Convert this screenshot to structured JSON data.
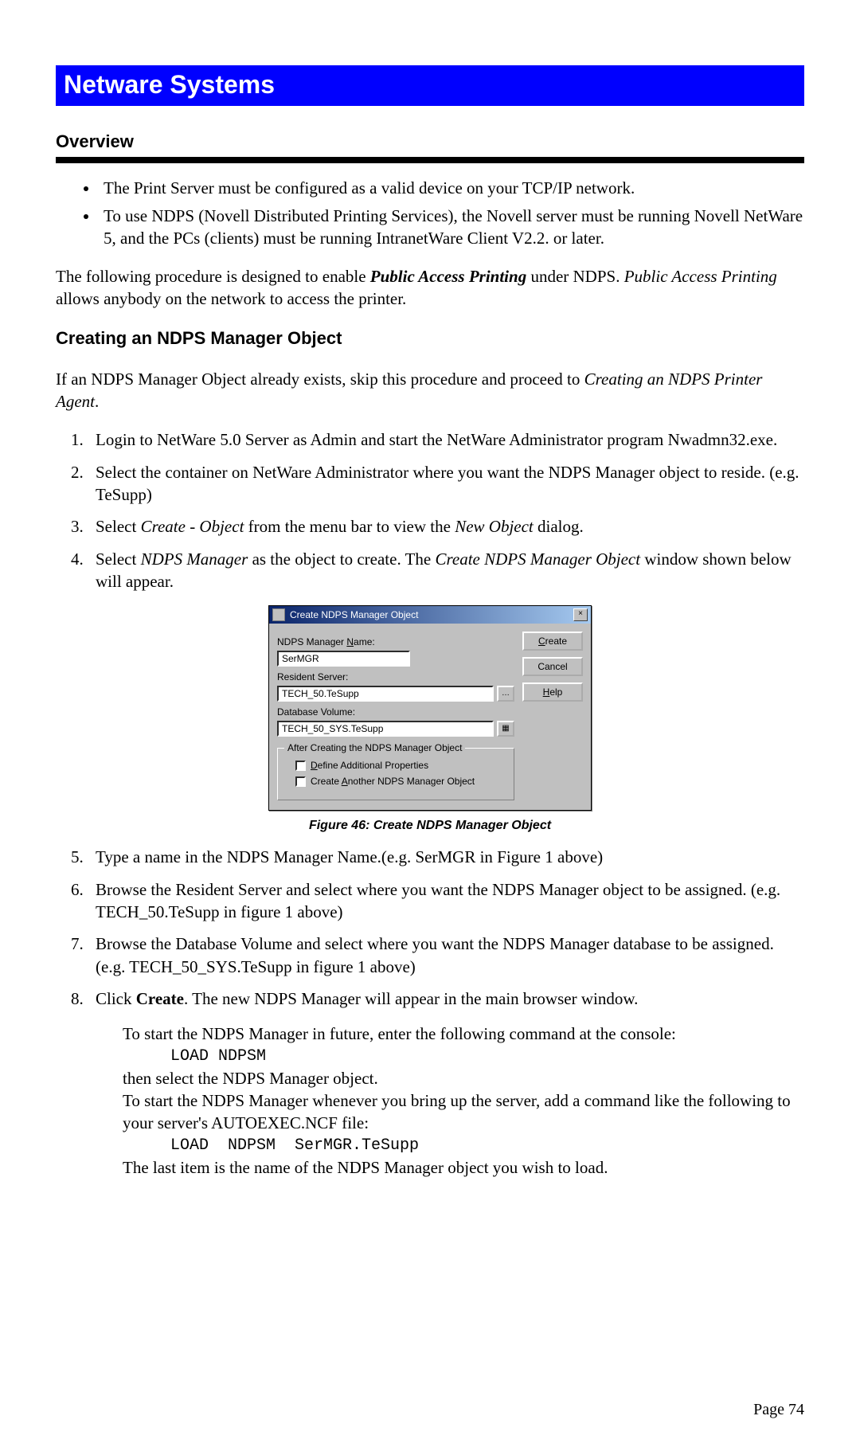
{
  "banner": "Netware Systems",
  "overview_heading": "Overview",
  "bullets": {
    "b1": "The Print Server must be configured as a valid device on your TCP/IP network.",
    "b2": "To use NDPS (Novell Distributed Printing Services), the Novell server must be running Novell NetWare 5, and the PCs (clients) must be running IntranetWare Client V2.2. or later."
  },
  "para1_a": "The following procedure is designed to enable ",
  "para1_b": "Public Access Printing",
  "para1_c": " under NDPS. ",
  "para1_d": "Public Access Printing",
  "para1_e": " allows anybody on the network to access the printer.",
  "sub_heading": "Creating an NDPS Manager Object",
  "para2_a": "If an NDPS Manager Object already exists, skip this procedure and proceed to ",
  "para2_b": "Creating an NDPS Printer Agent",
  "para2_c": ".",
  "steps": {
    "s1": "Login to NetWare 5.0 Server as Admin and start the NetWare Administrator program Nwadmn32.exe.",
    "s2": "Select the container on NetWare Administrator where you want the NDPS Manager object to reside. (e.g.  TeSupp)",
    "s3_a": "Select ",
    "s3_b": "Create - Object",
    "s3_c": " from the menu bar to view the ",
    "s3_d": "New Object",
    "s3_e": " dialog.",
    "s4_a": "Select ",
    "s4_b": "NDPS Manager",
    "s4_c": " as the object to create. The ",
    "s4_d": "Create NDPS Manager Object",
    "s4_e": " window shown below will appear.",
    "s5": "Type a name in the NDPS Manager Name.(e.g. SerMGR in Figure 1 above)",
    "s6": "Browse the Resident Server and select where you want the NDPS Manager object to be assigned. (e.g.  TECH_50.TeSupp in figure 1 above)",
    "s7": "Browse the Database Volume and select where you want the NDPS Manager database to be assigned. (e.g.  TECH_50_SYS.TeSupp in figure 1 above)",
    "s8_a": "Click ",
    "s8_b": "Create",
    "s8_c": ". The new NDPS Manager will appear in the main browser window."
  },
  "dialog": {
    "title": "Create NDPS Manager Object",
    "close": "×",
    "label_name_pre": "NDPS Manager ",
    "label_name_u": "N",
    "label_name_post": "ame:",
    "name_value": "SerMGR",
    "label_server": "Resident Server:",
    "server_value": "TECH_50.TeSupp",
    "browse1": "…",
    "label_volume": "Database Volume:",
    "volume_value": "TECH_50_SYS.TeSupp",
    "browse2": "▦",
    "group_legend": "After Creating the NDPS Manager Object",
    "chk1_u": "D",
    "chk1_post": "efine Additional Properties",
    "chk2_pre": "Create ",
    "chk2_u": "A",
    "chk2_post": "nother NDPS Manager Object",
    "btn_create_u": "C",
    "btn_create_post": "reate",
    "btn_cancel": "Cancel",
    "btn_help_u": "H",
    "btn_help_post": "elp"
  },
  "fig_caption": "Figure 46: Create NDPS Manager Object",
  "after": {
    "l1": "To start the NDPS Manager in future, enter the following command at the console:",
    "c1": "LOAD NDPSM",
    "l2": "then select the NDPS Manager object.",
    "l3": "To start the NDPS Manager whenever you bring up the server, add a command like the following to your server's AUTOEXEC.NCF file:",
    "c2": "LOAD  NDPSM  SerMGR.TeSupp",
    "l4": "The last item is the name of the NDPS Manager object you wish to load."
  },
  "page_num": "Page 74"
}
